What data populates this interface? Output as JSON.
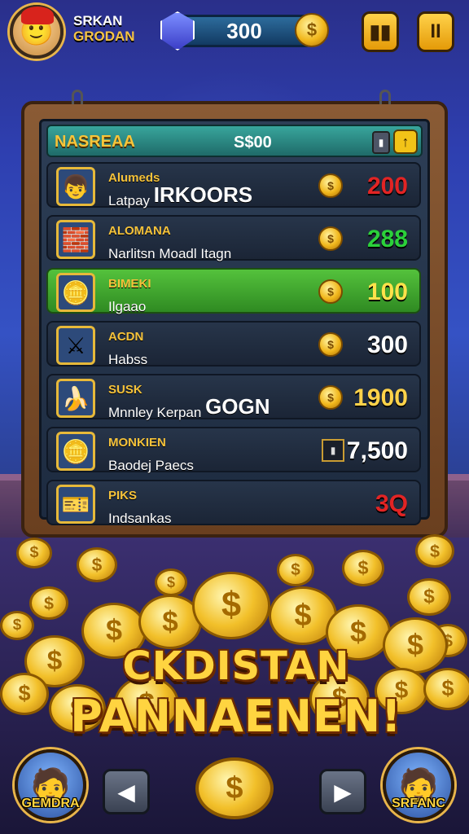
{
  "player": {
    "name": "SRKAN",
    "subtitle": "GRODAN"
  },
  "currency": {
    "amount": "300",
    "coin_symbol": "$"
  },
  "top_buttons": {
    "shop_icon": "bars-icon",
    "pause_icon": "pause-icon",
    "shop_label": "▮▮",
    "pause_label": "II"
  },
  "board": {
    "title": "NASREAA",
    "amount": "S$00",
    "lock_label": "▮",
    "action_label": "↑",
    "rows": [
      {
        "line1": "Alumeds",
        "line2": "Latpay",
        "line2_big": "IRKOORS",
        "value": "200",
        "value_color": "#e22424",
        "icon": "👦",
        "marker": "coin"
      },
      {
        "line1": "ALOMANA",
        "line2": "Narlitsn Moadl Itagn",
        "line2_big": "",
        "value": "288",
        "value_color": "#2bd13a",
        "icon": "🧱",
        "marker": "coin"
      },
      {
        "line1": "BIMEKI",
        "line2": "Ilgaao",
        "line2_big": "",
        "value": "100",
        "value_color": "#ffe24a",
        "icon": "🪙",
        "marker": "coin",
        "highlight": true
      },
      {
        "line1": "ACDN",
        "line2": "Habss",
        "line2_big": "",
        "value": "300",
        "value_color": "#ffffff",
        "icon": "⚔",
        "marker": "coin"
      },
      {
        "line1": "SUSK",
        "line2": "Mnnley Kerpan",
        "line2_big": "GOGN",
        "value": "1900",
        "value_color": "#ffd34a",
        "icon": "🍌",
        "marker": "coin"
      },
      {
        "line1": "MONKIEN",
        "line2": "Baodej Paecs",
        "line2_big": "",
        "value": "7,500",
        "value_color": "#ffffff",
        "icon": "🪙",
        "marker": "box"
      },
      {
        "line1": "PIKS",
        "line2": "Indsankas",
        "line2_big": "",
        "value": "3Q",
        "value_color": "#e22424",
        "icon": "🎫",
        "marker": "none"
      }
    ]
  },
  "banner": {
    "line1": "CKDISTAN",
    "line2": "PANNAENEN!"
  },
  "bottom": {
    "left_label": "GEMDRA",
    "right_label": "SRFANC",
    "left_arrow": "◀",
    "right_arrow": "▶",
    "center_coin": "$"
  },
  "colors": {
    "accent": "#f6c445",
    "board_wood": "#8a5b35",
    "highlight_row": "#54c23c"
  }
}
